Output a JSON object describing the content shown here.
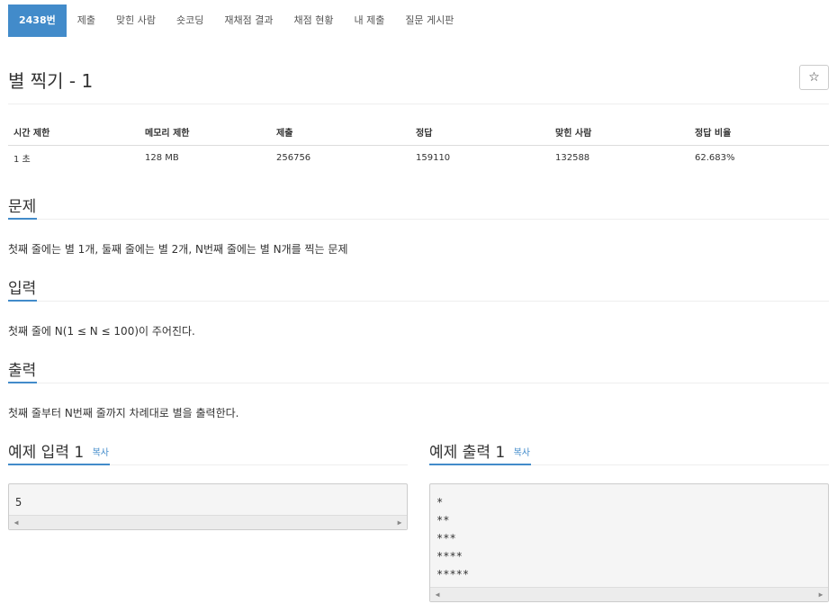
{
  "nav": {
    "tabs": [
      "2438번",
      "제출",
      "맞힌 사람",
      "숏코딩",
      "재채점 결과",
      "채점 현황",
      "내 제출",
      "질문 게시판"
    ]
  },
  "problem": {
    "title": "별 찍기 - 1",
    "star_icon": "☆"
  },
  "info_table": {
    "headers": [
      "시간 제한",
      "메모리 제한",
      "제출",
      "정답",
      "맞힌 사람",
      "정답 비율"
    ],
    "values": [
      "1 초",
      "128 MB",
      "256756",
      "159110",
      "132588",
      "62.683%"
    ]
  },
  "sections": {
    "description": {
      "title": "문제",
      "text": "첫째 줄에는 별 1개, 둘째 줄에는 별 2개, N번째 줄에는 별 N개를 찍는 문제"
    },
    "input": {
      "title": "입력",
      "text": "첫째 줄에 N(1 ≤ N ≤ 100)이 주어진다."
    },
    "output": {
      "title": "출력",
      "text": "첫째 줄부터 N번째 줄까지 차례대로 별을 출력한다."
    }
  },
  "samples": {
    "input": {
      "title": "예제 입력 1",
      "copy_label": "복사",
      "content": "5"
    },
    "output": {
      "title": "예제 출력 1",
      "copy_label": "복사",
      "content": "*\n**\n***\n****\n*****"
    }
  },
  "colors": {
    "accent": "#428bca"
  }
}
